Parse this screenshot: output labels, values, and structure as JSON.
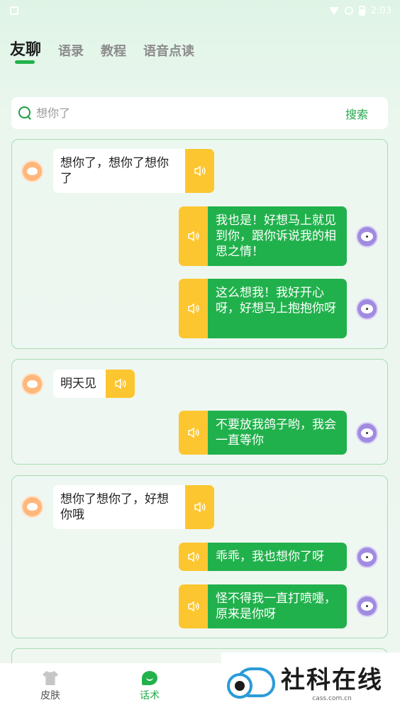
{
  "status": {
    "time": "2:03"
  },
  "tabs": [
    {
      "label": "友聊",
      "active": true
    },
    {
      "label": "语录",
      "active": false
    },
    {
      "label": "教程",
      "active": false
    },
    {
      "label": "语音点读",
      "active": false
    }
  ],
  "search": {
    "placeholder": "想你了",
    "button": "搜索"
  },
  "conversations": [
    {
      "messages": [
        {
          "side": "left",
          "avatar": "fox-avatar",
          "text": "想你了，想你了想你了"
        },
        {
          "side": "right",
          "avatar": "bear-avatar",
          "text": "我也是！好想马上就见到你，跟你诉说我的相思之情！"
        },
        {
          "side": "right",
          "avatar": "bear-avatar",
          "text": "这么想我！我好开心呀，好想马上抱抱你呀"
        }
      ]
    },
    {
      "messages": [
        {
          "side": "left",
          "avatar": "fox-avatar",
          "text": "明天见"
        },
        {
          "side": "right",
          "avatar": "bear-avatar",
          "text": "不要放我鸽子哟，我会一直等你"
        }
      ]
    },
    {
      "messages": [
        {
          "side": "left",
          "avatar": "fox-avatar",
          "text": "想你了想你了，好想你哦"
        },
        {
          "side": "right",
          "avatar": "bear-avatar",
          "text": "乖乖，我也想你了呀"
        },
        {
          "side": "right",
          "avatar": "bear-avatar",
          "text": "怪不得我一直打喷嚏，原来是你呀"
        }
      ]
    }
  ],
  "bottom_nav": [
    {
      "label": "皮肤",
      "icon": "shirt-icon",
      "active": false
    },
    {
      "label": "话术",
      "icon": "chat-icon",
      "active": true
    }
  ],
  "watermark": {
    "title": "社科在线",
    "subtitle": "cass.com.cn"
  },
  "colors": {
    "accent": "#22b24c",
    "speaker": "#fcc631",
    "card_border": "#a9dcb4"
  }
}
